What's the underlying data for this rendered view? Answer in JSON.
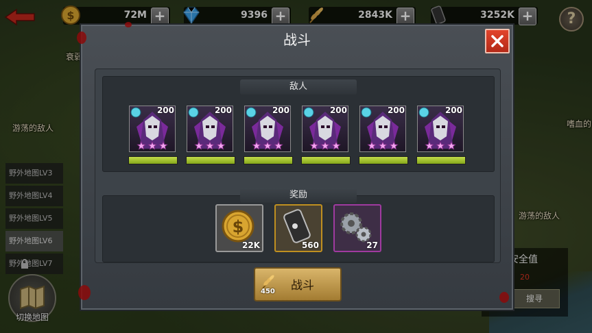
{
  "resources": [
    {
      "name": "gold",
      "value": "72M",
      "icon": "gold-coin-icon",
      "color": "#d8a530"
    },
    {
      "name": "gems",
      "value": "9396",
      "icon": "diamond-icon",
      "color": "#3aa0e8"
    },
    {
      "name": "food",
      "value": "2843K",
      "icon": "wheat-icon",
      "color": "#c8963c"
    },
    {
      "name": "oil",
      "value": "3252K",
      "icon": "oil-barrel-icon",
      "color": "#444444"
    }
  ],
  "help_label": "?",
  "side_menu": {
    "items": [
      {
        "label": "野外地图LV3"
      },
      {
        "label": "野外地图LV4"
      },
      {
        "label": "野外地图LV5"
      },
      {
        "label": "野外地图LV6",
        "active": true
      },
      {
        "label": "野外地图LV7",
        "locked": true
      }
    ],
    "switch_map_label": "切换地图"
  },
  "background_labels": {
    "wandering_enemy_left": "游荡的敌人",
    "wandering_enemy_right": "游荡的敌人",
    "bloodthirsty": "嗜血的",
    "decline": "衰弱"
  },
  "safety_panel": {
    "title": "安全值",
    "value": "20",
    "button_label": "搜寻"
  },
  "dialog": {
    "title": "战斗",
    "enemies_label": "敌人",
    "rewards_label": "奖励",
    "enemies": [
      {
        "level": "200",
        "stars": 3
      },
      {
        "level": "200",
        "stars": 3
      },
      {
        "level": "200",
        "stars": 3
      },
      {
        "level": "200",
        "stars": 3
      },
      {
        "level": "200",
        "stars": 3
      },
      {
        "level": "200",
        "stars": 3
      }
    ],
    "rewards": [
      {
        "type": "gold",
        "amount": "22K",
        "icon": "gold-coin-icon",
        "border": "#9a9a9a"
      },
      {
        "type": "oil",
        "amount": "560",
        "icon": "oil-barrel-icon",
        "border": "#c09020"
      },
      {
        "type": "gears",
        "amount": "27",
        "icon": "gears-icon",
        "border": "#a03aa0"
      }
    ],
    "fight_button": {
      "label": "战斗",
      "cost": "450",
      "cost_icon": "wheat-icon"
    }
  }
}
